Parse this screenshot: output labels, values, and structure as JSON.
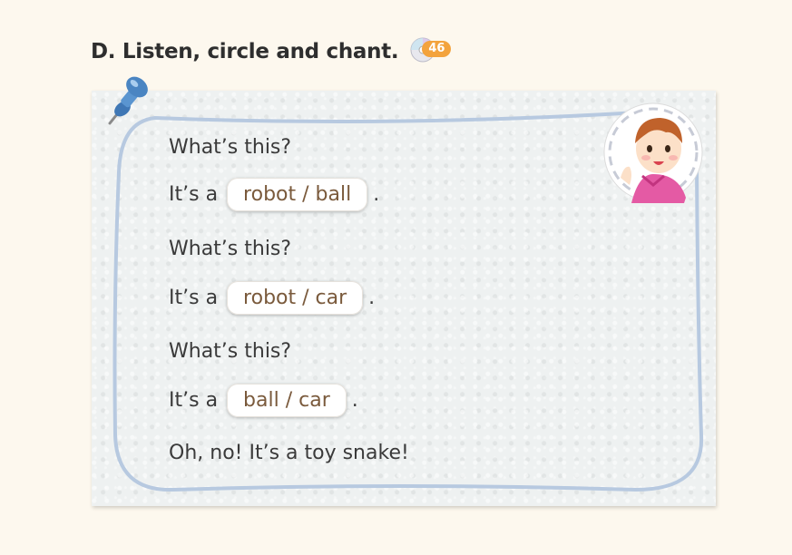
{
  "heading": {
    "title": "D. Listen, circle and chant.",
    "track_number": "46"
  },
  "chant": {
    "q1": "What’s this?",
    "a1_prefix": "It’s a",
    "a1_choices": "robot / ball",
    "a1_end": ".",
    "q2": "What’s this?",
    "a2_prefix": "It’s a",
    "a2_choices": "robot / car",
    "a2_end": ".",
    "q3": "What’s this?",
    "a3_prefix": "It’s a",
    "a3_choices": "ball / car",
    "a3_end": ".",
    "closing": "Oh, no! It’s a toy snake!"
  },
  "colors": {
    "frame_line": "#b7c9e0",
    "pin": "#4a85c2",
    "track_badge": "#f3a33d",
    "choice_text": "#7a5a3c"
  }
}
